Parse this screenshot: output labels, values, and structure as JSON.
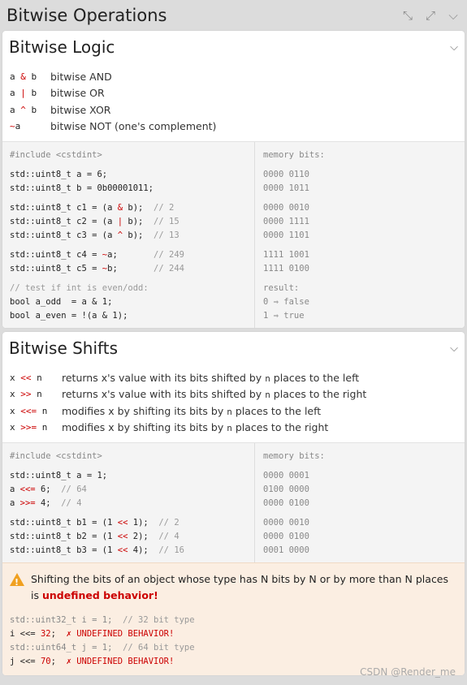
{
  "app": {
    "title": "Bitwise Operations",
    "icons": [
      "collapse-icon",
      "expand-icon",
      "chevron-down-icon"
    ]
  },
  "logic": {
    "title": "Bitwise Logic",
    "ops": [
      {
        "a": "a ",
        "op": "&",
        "b": " b",
        "desc": "bitwise AND"
      },
      {
        "a": "a ",
        "op": "|",
        "b": " b",
        "desc": "bitwise OR"
      },
      {
        "a": "a ",
        "op": "^",
        "b": " b",
        "desc": "bitwise XOR"
      },
      {
        "a": "",
        "op": "~",
        "b": "a",
        "desc": "bitwise NOT (one's complement)"
      }
    ],
    "include": "#include <cstdint>",
    "memory_label": "memory bits:",
    "code": {
      "a_decl": "std::uint8_t a = 6;",
      "b_decl": "std::uint8_t b = 0b00001011;",
      "c1_pre": "std::uint8_t c1 = (a ",
      "c1_op": "&",
      "c1_post": " b);  ",
      "c1_cmt": "// 2",
      "c2_pre": "std::uint8_t c2 = (a ",
      "c2_op": "|",
      "c2_post": " b);  ",
      "c2_cmt": "// 15",
      "c3_pre": "std::uint8_t c3 = (a ",
      "c3_op": "^",
      "c3_post": " b);  ",
      "c3_cmt": "// 13",
      "c4_pre": "std::uint8_t c4 = ",
      "c4_op": "~",
      "c4_post": "a;       ",
      "c4_cmt": "// 249",
      "c5_pre": "std::uint8_t c5 = ",
      "c5_op": "~",
      "c5_post": "b;       ",
      "c5_cmt": "// 244",
      "test_cmt": "// test if int is even/odd:",
      "odd": "bool a_odd  = a & 1;",
      "even": "bool a_even = !(a & 1);"
    },
    "memory": [
      "0000 0110",
      "0000 1011",
      "0000 0010",
      "0000 1111",
      "0000 1101",
      "1111 1001",
      "1111 0100"
    ],
    "result_label": "result:",
    "results": [
      "0 ⇒ false",
      "1 ⇒ true"
    ]
  },
  "shifts": {
    "title": "Bitwise Shifts",
    "ops": [
      {
        "a": "x ",
        "op": "<<",
        "b": " n  ",
        "d1": "returns x's value with its bits shifted by ",
        "d2": " places to the left"
      },
      {
        "a": "x ",
        "op": ">>",
        "b": " n  ",
        "d1": "returns x's value with its bits shifted by ",
        "d2": " places to the right"
      },
      {
        "a": "x ",
        "op": "<<=",
        "b": " n ",
        "d1": "modifies x by shifting its bits by ",
        "d2": " places to the left"
      },
      {
        "a": "x ",
        "op": ">>=",
        "b": " n ",
        "d1": "modifies x by shifting its bits by ",
        "d2": " places to the right"
      }
    ],
    "n": "n",
    "include": "#include <cstdint>",
    "memory_label": "memory bits:",
    "code": {
      "a_decl": "std::uint8_t a = 1;",
      "l1_pre": "a ",
      "l1_op": "<<=",
      "l1_post": " 6;  ",
      "l1_cmt": "// 64",
      "l2_pre": "a ",
      "l2_op": ">>=",
      "l2_post": " 4;  ",
      "l2_cmt": "// 4",
      "b1_pre": "std::uint8_t b1 = (1 ",
      "b1_op": "<<",
      "b1_post": " 1);  ",
      "b1_cmt": "// 2",
      "b2_pre": "std::uint8_t b2 = (1 ",
      "b2_op": "<<",
      "b2_post": " 2);  ",
      "b2_cmt": "// 4",
      "b3_pre": "std::uint8_t b3 = (1 ",
      "b3_op": "<<",
      "b3_post": " 4);  ",
      "b3_cmt": "// 16"
    },
    "memory": [
      "0000 0001",
      "0100 0000",
      "0000 0100",
      "0000 0010",
      "0000 0100",
      "0001 0000"
    ],
    "warning": {
      "text": "Shifting the bits of an object whose type has N bits by N or by more than N places is",
      "strong": "undefined behavior!",
      "l1_code": "std::uint32_t i = 1;  ",
      "l1_cmt": "// 32 bit type",
      "l2_pre": "i <<= ",
      "l2_num": "32",
      "l2_post": ";  ",
      "l2_err": "✗ UNDEFINED BEHAVIOR!",
      "l3_code": "std::uint64_t j = 1;  ",
      "l3_cmt": "// 64 bit type",
      "l4_pre": "j <<= ",
      "l4_num": "70",
      "l4_post": ";  ",
      "l4_err": "✗ UNDEFINED BEHAVIOR!"
    }
  },
  "watermark": "CSDN @Render_me"
}
